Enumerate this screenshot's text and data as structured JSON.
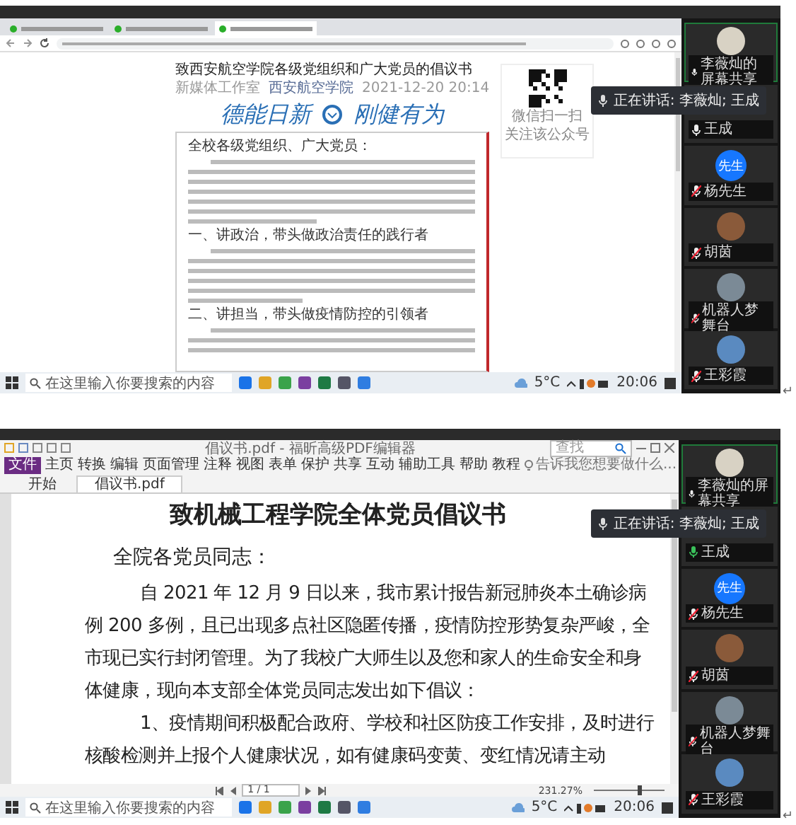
{
  "browser_screen": {
    "tabs": [
      {
        "selected": false
      },
      {
        "selected": false
      },
      {
        "selected": true
      }
    ],
    "article": {
      "title": "致西安航空学院各级党组织和广大党员的倡议书",
      "source": "新媒体工作室",
      "account": "西安航空学院",
      "date": "2021-12-20 20:14",
      "banner": [
        "德能日新",
        "刚健有为"
      ],
      "qr_caption": [
        "微信扫一扫",
        "关注该公众号"
      ],
      "greeting": "全校各级党组织、广大党员：",
      "headings": [
        "一、讲政治，带头做政治责任的践行者",
        "二、讲担当，带头做疫情防控的引领者"
      ]
    },
    "speaking_tooltip": "正在讲话: 李薇灿; 王成",
    "participants": [
      {
        "name": "李薇灿的屏幕共享",
        "kind": "photo",
        "selected": true,
        "muted": false,
        "speaking": false
      },
      {
        "name": "王成",
        "kind": "hidden",
        "selected": false,
        "muted": false,
        "speaking": false
      },
      {
        "name": "杨先生",
        "kind": "text",
        "avatar_text": "先生",
        "selected": false,
        "muted": true,
        "speaking": false
      },
      {
        "name": "胡茵",
        "kind": "photo",
        "selected": false,
        "muted": true,
        "speaking": false
      },
      {
        "name": "机器人梦舞台",
        "kind": "photo",
        "selected": false,
        "muted": true,
        "speaking": false
      },
      {
        "name": "王彩霞",
        "kind": "photo",
        "selected": false,
        "muted": true,
        "speaking": false
      }
    ],
    "taskbar": {
      "search_placeholder": "在这里输入你要搜索的内容",
      "weather": "5°C",
      "time": "20:06"
    },
    "end_mark": "↵"
  },
  "pdf_screen": {
    "window_title": "倡议书.pdf - 福昕高级PDF编辑器",
    "menu": [
      {
        "label": "文件",
        "kind": "file"
      },
      {
        "label": "主页",
        "kind": "menu"
      },
      {
        "label": "转换",
        "kind": "menu"
      },
      {
        "label": "编辑",
        "kind": "menu"
      },
      {
        "label": "页面管理",
        "kind": "menu"
      },
      {
        "label": "注释",
        "kind": "menu"
      },
      {
        "label": "视图",
        "kind": "menu"
      },
      {
        "label": "表单",
        "kind": "menu"
      },
      {
        "label": "保护",
        "kind": "menu"
      },
      {
        "label": "共享",
        "kind": "menu"
      },
      {
        "label": "互动",
        "kind": "menu"
      },
      {
        "label": "辅助工具",
        "kind": "menu"
      },
      {
        "label": "帮助",
        "kind": "menu"
      },
      {
        "label": "教程",
        "kind": "menu"
      }
    ],
    "menu_search": "告诉我您想要做什么...",
    "find_placeholder": "查找",
    "tabs": [
      {
        "label": "开始",
        "selected": false
      },
      {
        "label": "倡议书.pdf",
        "selected": true
      }
    ],
    "document": {
      "title": "致机械工程学院全体党员倡议书",
      "greeting": "全院各党员同志：",
      "paragraphs": [
        "自 2021 年 12 月 9 日以来，我市累计报告新冠肺炎本土确诊病例 200 多例，且已出现多点社区隐匿传播，疫情防控形势复杂严峻，全市现已实行封闭管理。为了我校广大师生以及您和家人的生命安全和身体健康，现向本支部全体党员同志发出如下倡议：",
        "1、疫情期间积极配合政府、学校和社区防疫工作安排，及时进行核酸检测并上报个人健康状况，如有健康码变黄、变红情况请主动"
      ]
    },
    "page_indicator": "1 / 1",
    "zoom": "231.27%",
    "zoom_slider": {
      "level": 0.64
    },
    "speaking_tooltip": "正在讲话: 李薇灿; 王成",
    "participants": [
      {
        "name": "李薇灿的屏幕共享",
        "kind": "photo",
        "selected": true,
        "muted": false,
        "speaking": false
      },
      {
        "name": "王成",
        "kind": "hidden",
        "selected": false,
        "muted": false,
        "speaking": true
      },
      {
        "name": "杨先生",
        "kind": "text",
        "avatar_text": "先生",
        "selected": false,
        "muted": true,
        "speaking": false
      },
      {
        "name": "胡茵",
        "kind": "photo",
        "selected": false,
        "muted": true,
        "speaking": false
      },
      {
        "name": "机器人梦舞台",
        "kind": "photo",
        "selected": false,
        "muted": true,
        "speaking": false
      },
      {
        "name": "王彩霞",
        "kind": "photo",
        "selected": false,
        "muted": true,
        "speaking": false
      }
    ],
    "taskbar": {
      "search_placeholder": "在这里输入你要搜索的内容",
      "weather": "5°C",
      "time": "20:06"
    },
    "end_mark": "↵"
  }
}
